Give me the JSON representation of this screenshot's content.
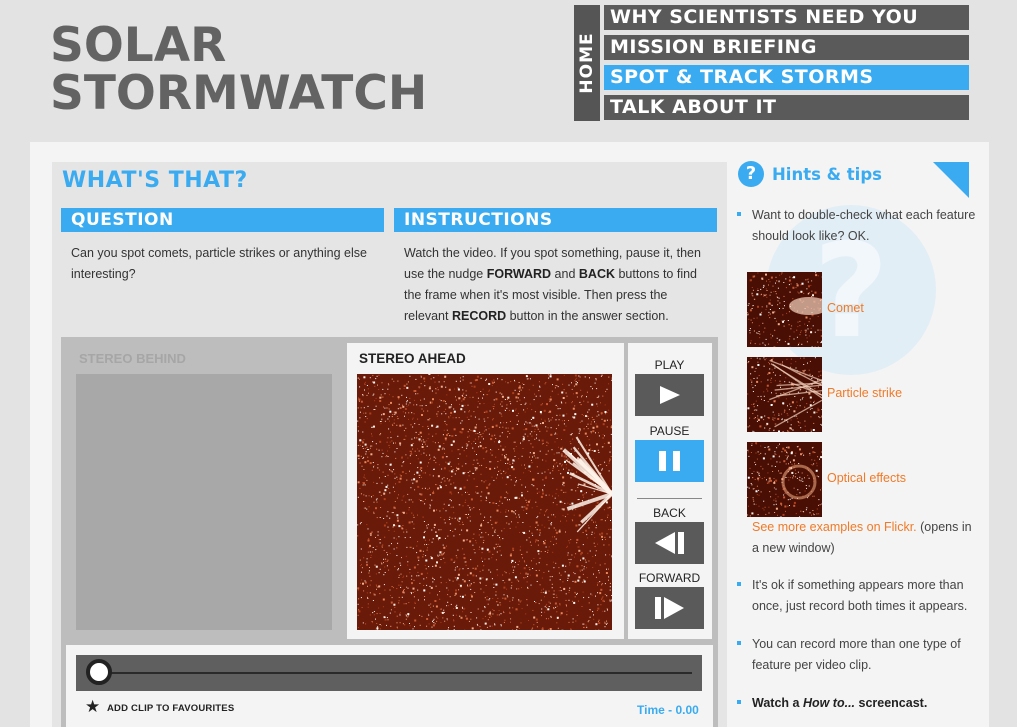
{
  "header": {
    "logo_line1": "SOLAR",
    "logo_line2": "STORMWATCH",
    "home_label": "HOME",
    "nav": [
      {
        "label": "WHY SCIENTISTS NEED YOU",
        "active": false
      },
      {
        "label": "MISSION BRIEFING",
        "active": false
      },
      {
        "label": "SPOT & TRACK STORMS",
        "active": true
      },
      {
        "label": "TALK ABOUT IT",
        "active": false
      }
    ]
  },
  "main": {
    "heading": "WHAT'S THAT?",
    "question": {
      "title": "QUESTION",
      "text": "Can you spot comets, particle strikes or anything else interesting?"
    },
    "instructions": {
      "title": "INSTRUCTIONS",
      "part1": "Watch the video. If you spot something, pause it, then use the nudge ",
      "forward": "FORWARD",
      "and": " and ",
      "back": "BACK",
      "part2": " buttons to find the frame when it's most visible. Then press the relevant ",
      "record": "RECORD",
      "part3": " button in the answer section."
    }
  },
  "player": {
    "behind_label": "STEREO BEHIND",
    "ahead_label": "STEREO AHEAD",
    "controls": {
      "play": "PLAY",
      "pause": "PAUSE",
      "back": "BACK",
      "forward": "FORWARD"
    },
    "playback_position": 0,
    "favourites_label": "ADD CLIP TO FAVOURITES",
    "time_readout": "Time - 0.00"
  },
  "hints": {
    "title": "Hints & tips",
    "intro": "Want to double-check what each feature should look like? OK.",
    "examples": [
      {
        "label": "Comet"
      },
      {
        "label": "Particle strike"
      },
      {
        "label": "Optical effects"
      }
    ],
    "flickr_link": "See more examples on Flickr.",
    "flickr_note": " (opens in a new window)",
    "tip2": "It's ok if something appears more than once, just record both times it appears.",
    "tip3": "You can record more than one type of feature per video clip.",
    "screencast_prefix": "Watch a ",
    "screencast_italic": "How to...",
    "screencast_suffix": " screencast."
  },
  "colors": {
    "accent": "#3aabf0",
    "nav_bg": "#5a5a5a",
    "link": "#f07a28",
    "logo": "#636363"
  }
}
